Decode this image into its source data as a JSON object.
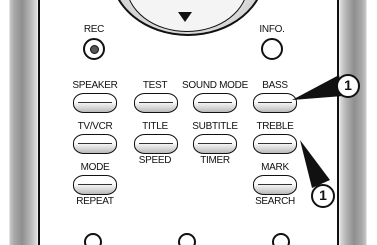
{
  "buttons": {
    "rec": "REC",
    "info": "INFO.",
    "speaker": "SPEAKER",
    "test": "TEST",
    "sound_mode": "SOUND MODE",
    "bass": "BASS",
    "tv_vcr": "TV/VCR",
    "title": "TITLE",
    "subtitle": "SUBTITLE",
    "treble": "TREBLE",
    "speed": "SPEED",
    "timer": "TIMER",
    "mode": "MODE",
    "mark": "MARK",
    "repeat": "REPEAT",
    "search": "SEARCH"
  },
  "callouts": {
    "bass_callout": "1",
    "treble_callout": "1"
  },
  "icons": {
    "dpad": "down-arrow-icon",
    "rec": "record-dot-icon"
  }
}
